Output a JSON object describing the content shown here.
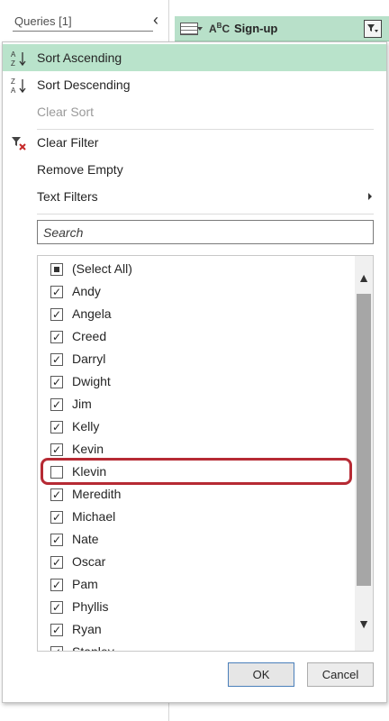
{
  "queries_pane": {
    "title": "Queries [1]",
    "collapse_icon": "chevron-left-icon"
  },
  "column_header": {
    "type_icon": "abc-text-type-icon",
    "type_text": "ABC",
    "title": "Sign-up",
    "filter_icon": "filter-dropdown-icon"
  },
  "menu": {
    "items": [
      {
        "label": "Sort Ascending",
        "icon": "sort-ascending-icon",
        "state": "selected"
      },
      {
        "label": "Sort Descending",
        "icon": "sort-descending-icon",
        "state": "normal"
      },
      {
        "label": "Clear Sort",
        "icon": "",
        "state": "disabled"
      },
      {
        "label": "Clear Filter",
        "icon": "clear-filter-icon",
        "state": "normal"
      },
      {
        "label": "Remove Empty",
        "icon": "",
        "state": "normal"
      },
      {
        "label": "Text Filters",
        "icon": "submenu-arrow-icon",
        "state": "normal"
      }
    ]
  },
  "search": {
    "placeholder": "Search"
  },
  "values_list": {
    "items": [
      {
        "label": "(Select All)",
        "state": "partial"
      },
      {
        "label": "Andy",
        "state": "checked"
      },
      {
        "label": "Angela",
        "state": "checked"
      },
      {
        "label": "Creed",
        "state": "checked"
      },
      {
        "label": "Darryl",
        "state": "checked"
      },
      {
        "label": "Dwight",
        "state": "checked"
      },
      {
        "label": "Jim",
        "state": "checked"
      },
      {
        "label": "Kelly",
        "state": "checked"
      },
      {
        "label": "Kevin",
        "state": "checked"
      },
      {
        "label": "Klevin",
        "state": "unchecked"
      },
      {
        "label": "Meredith",
        "state": "checked"
      },
      {
        "label": "Michael",
        "state": "checked"
      },
      {
        "label": "Nate",
        "state": "checked"
      },
      {
        "label": "Oscar",
        "state": "checked"
      },
      {
        "label": "Pam",
        "state": "checked"
      },
      {
        "label": "Phyllis",
        "state": "checked"
      },
      {
        "label": "Ryan",
        "state": "checked"
      },
      {
        "label": "Stanley",
        "state": "checked"
      }
    ],
    "highlighted_item": "Klevin",
    "highlight_color": "#b62a34"
  },
  "buttons": {
    "ok": "OK",
    "cancel": "Cancel"
  },
  "colors": {
    "accent_green": "#b9e3cb",
    "header_green": "#b8e0c9"
  }
}
